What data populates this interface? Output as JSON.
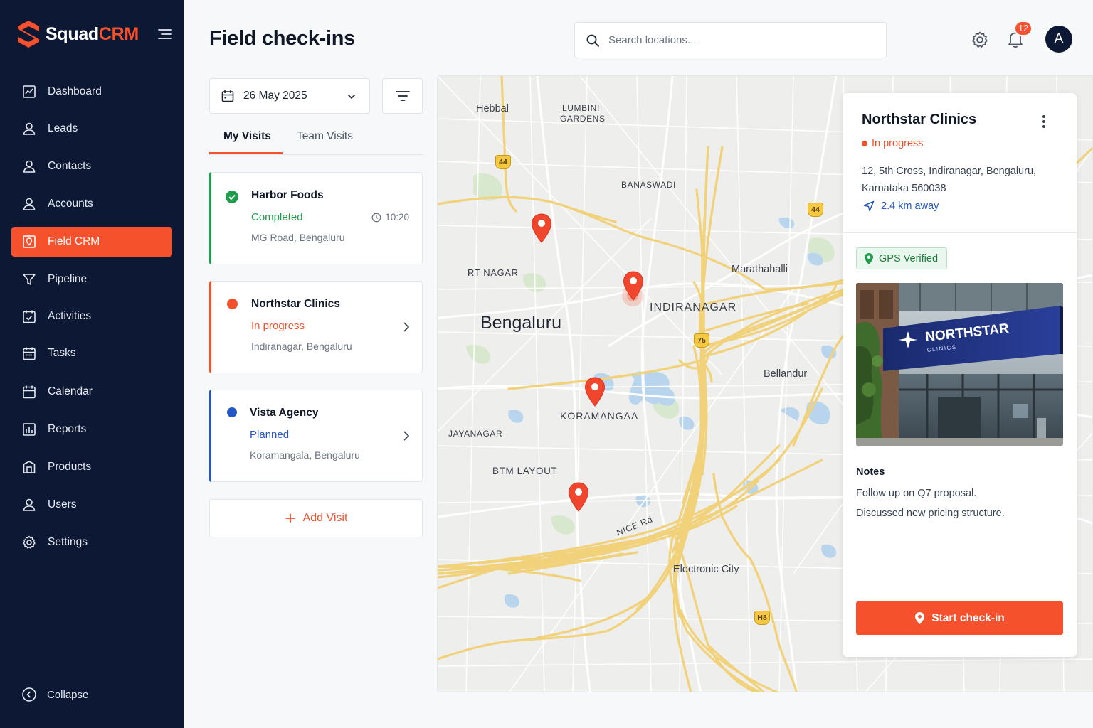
{
  "brand": {
    "name_part1": "Squad",
    "name_part2": "CRM"
  },
  "sidebar": {
    "items": [
      {
        "label": "Dashboard",
        "icon": "dashboard-icon"
      },
      {
        "label": "Leads",
        "icon": "user-icon"
      },
      {
        "label": "Contacts",
        "icon": "user-icon"
      },
      {
        "label": "Accounts",
        "icon": "user-icon"
      },
      {
        "label": "Field CRM",
        "icon": "field-crm-icon",
        "active": true
      },
      {
        "label": "Pipeline",
        "icon": "funnel-icon"
      },
      {
        "label": "Activities",
        "icon": "calendar-check-icon"
      },
      {
        "label": "Tasks",
        "icon": "calendar-icon"
      },
      {
        "label": "Calendar",
        "icon": "calendar-icon"
      },
      {
        "label": "Reports",
        "icon": "chart-icon"
      },
      {
        "label": "Products",
        "icon": "building-icon"
      },
      {
        "label": "Users",
        "icon": "user-icon"
      },
      {
        "label": "Settings",
        "icon": "gear-icon"
      }
    ],
    "collapse_label": "Collapse"
  },
  "header": {
    "title": "Field check-ins",
    "search_placeholder": "Search locations...",
    "notification_count": "12",
    "avatar_initial": "A"
  },
  "filters": {
    "date": "26 May 2025",
    "tabs": [
      "My Visits",
      "Team Visits"
    ]
  },
  "visits": [
    {
      "name": "Harbor Foods",
      "status": "Completed",
      "location": "MG Road, Bengaluru",
      "time": "10:20",
      "color": "#1f9d4c"
    },
    {
      "name": "Northstar Clinics",
      "status": "In progress",
      "location": "Indiranagar, Bengaluru",
      "color": "#f4512c"
    },
    {
      "name": "Vista Agency",
      "status": "Planned",
      "location": "Koramangala, Bengaluru",
      "color": "#2457c5"
    }
  ],
  "add_visit_label": "Add Visit",
  "map": {
    "labels": {
      "hebbal": "Hebbal",
      "lumbini1": "LUMBINI",
      "lumbini2": "GARDENS",
      "banaswadi": "BANASWADI",
      "rt_nagar": "RT NAGAR",
      "marathahalli": "Marathahalli",
      "bengaluru": "Bengaluru",
      "indiranagar": "INDIRANAGAR",
      "bellandur": "Bellandur",
      "koramangala": "KORAMANGAA",
      "jayanagar": "JAYANAGAR",
      "btm": "BTM LAYOUT",
      "nice_rd": "NICE Rd",
      "electronic_city": "Electronic City"
    },
    "shields": {
      "s1": "44",
      "s2": "44",
      "s3": "75",
      "s4": "H8"
    }
  },
  "details": {
    "name": "Northstar Clinics",
    "status": "In progress",
    "address": "12, 5th Cross, Indiranagar, Bengaluru, Karnataka 560038",
    "distance": "2.4 km away",
    "gps_label": "GPS Verified",
    "photo_sign": "NORTHSTAR",
    "photo_sign_sub": "CLINICS",
    "notes_title": "Notes",
    "notes": [
      "Follow up on Q7 proposal.",
      "Discussed new pricing structure."
    ],
    "checkin_label": "Start check-in"
  },
  "colors": {
    "accent": "#f4512c",
    "sidebar_bg": "#0c1834",
    "success": "#1f9d4c",
    "info": "#2457c5"
  }
}
